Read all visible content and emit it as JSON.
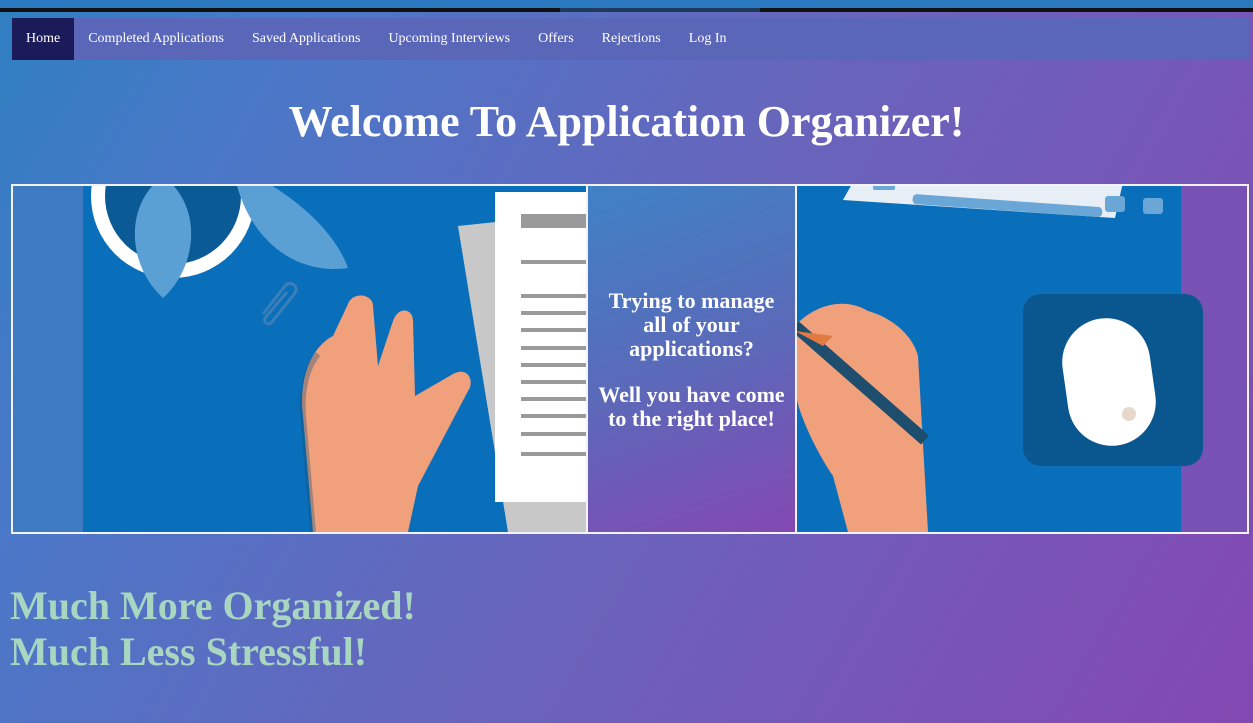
{
  "nav": {
    "items": [
      {
        "label": "Home",
        "active": true
      },
      {
        "label": "Completed Applications"
      },
      {
        "label": "Saved Applications"
      },
      {
        "label": "Upcoming Interviews"
      },
      {
        "label": "Offers"
      },
      {
        "label": "Rejections"
      },
      {
        "label": "Log In"
      }
    ]
  },
  "page": {
    "title": "Welcome To Application Organizer!"
  },
  "banner": {
    "callout_line1": "Trying to manage all of your applications?",
    "callout_line2": "Well you have come to the right place!",
    "icons": [
      "plant-icon",
      "paperclip-icon",
      "document-icon",
      "hand-icon",
      "pen-icon",
      "keyboard-icon",
      "mouse-icon"
    ]
  },
  "slogan": {
    "line1": "Much More Organized!",
    "line2": "Much Less Stressful!"
  },
  "colors": {
    "nav_bg": "#5a66b8",
    "nav_active": "#1b1b5a",
    "banner_blue": "#0a6fbb",
    "slogan": "#a8d6c0"
  }
}
